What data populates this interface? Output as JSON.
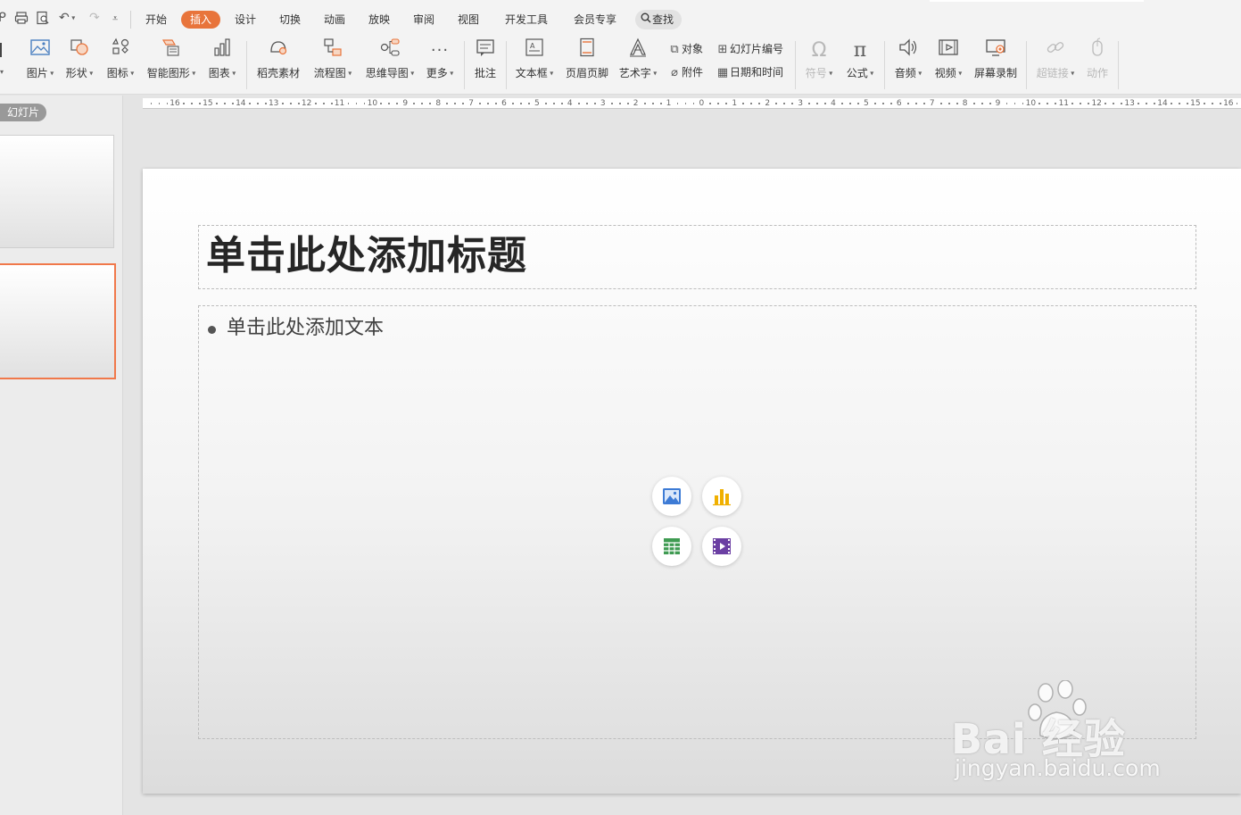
{
  "quick_access": {
    "icons": [
      "back-icon",
      "print-icon",
      "print-preview-icon",
      "undo-icon",
      "redo-icon",
      "customize-icon"
    ]
  },
  "menu": {
    "tabs": [
      {
        "label": "开始",
        "active": false
      },
      {
        "label": "插入",
        "active": true
      },
      {
        "label": "设计",
        "active": false
      },
      {
        "label": "切换",
        "active": false
      },
      {
        "label": "动画",
        "active": false
      },
      {
        "label": "放映",
        "active": false
      },
      {
        "label": "审阅",
        "active": false
      },
      {
        "label": "视图",
        "active": false
      },
      {
        "label": "开发工具",
        "active": false
      },
      {
        "label": "会员专享",
        "active": false
      }
    ],
    "search_label": "查找"
  },
  "ribbon": {
    "picture": "图片",
    "shape": "形状",
    "icon": "图标",
    "smart_art": "智能图形",
    "chart": "图表",
    "material": "稻壳素材",
    "flowchart": "流程图",
    "mindmap": "思维导图",
    "more": "更多",
    "comment": "批注",
    "textbox": "文本框",
    "header_footer": "页眉页脚",
    "art_text": "艺术字",
    "object": "对象",
    "attachment": "附件",
    "slide_number": "幻灯片编号",
    "date_time": "日期和时间",
    "symbol": "符号",
    "formula": "公式",
    "audio": "音频",
    "video": "视频",
    "screen_record": "屏幕录制",
    "hyperlink": "超链接",
    "action": "动作"
  },
  "ruler": {
    "labels": [
      "16",
      "15",
      "14",
      "13",
      "12",
      "11",
      "10",
      "9",
      "8",
      "7",
      "6",
      "5",
      "4",
      "3",
      "2",
      "1",
      "0",
      "1",
      "2",
      "3",
      "4",
      "5",
      "6",
      "7",
      "8",
      "9",
      "10",
      "11",
      "12",
      "13",
      "14",
      "15",
      "16"
    ]
  },
  "panel": {
    "tag": "幻灯片"
  },
  "slide": {
    "title_placeholder": "单击此处添加标题",
    "body_placeholder": "单击此处添加文本",
    "insert_buttons": [
      "insert-picture-icon",
      "insert-chart-icon",
      "insert-table-icon",
      "insert-video-icon"
    ]
  },
  "watermark": {
    "main": "Bai  经验",
    "sub": "jingyan.baidu.com"
  },
  "colors": {
    "accent": "#e8743b",
    "selection": "#f0784a",
    "picture_icon": "#3d7bd5",
    "chart_icon": "#f0b000",
    "table_icon": "#3f9b52",
    "video_icon": "#6b3fa3"
  }
}
